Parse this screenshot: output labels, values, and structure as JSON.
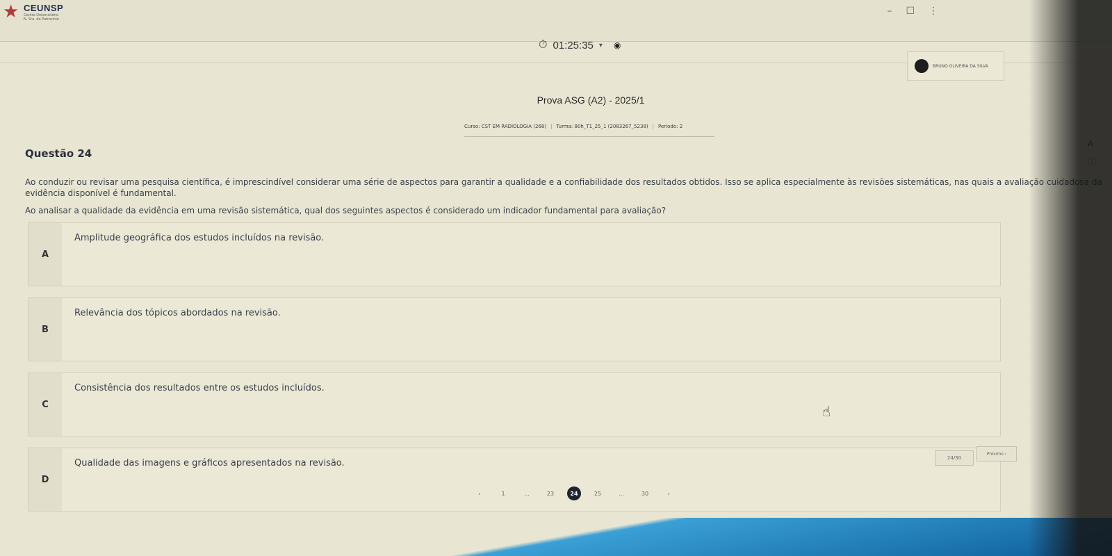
{
  "header": {
    "logo_name": "CEUNSP",
    "logo_sub_1": "Centro Universitário",
    "logo_sub_2": "N. Sra. do Patrocínio",
    "timer": "01:25:35",
    "user_name": "BRUNO OLIVEIRA DA SILVA"
  },
  "exam": {
    "title": "Prova ASG (A2) - 2025/1",
    "course": "Curso: CST EM RADIOLOGIA (268)",
    "class": "Turma: 80h_T1_25_1 (2083267_5238)",
    "period": "Período: 2"
  },
  "question": {
    "title": "Questão 24",
    "text": "Ao conduzir ou revisar uma pesquisa científica, é imprescindível considerar uma série de aspectos para garantir a qualidade e a confiabilidade dos resultados obtidos. Isso se aplica especialmente às revisões sistemáticas, nas quais a avaliação cuidadosa da evidência disponível é fundamental.",
    "prompt": "Ao analisar a qualidade da evidência em uma revisão sistemática, qual dos seguintes aspectos é considerado um indicador fundamental para avaliação?",
    "options": [
      {
        "letter": "A",
        "text": "Amplitude geográfica dos estudos incluídos na revisão."
      },
      {
        "letter": "B",
        "text": "Relevância dos tópicos abordados na revisão."
      },
      {
        "letter": "C",
        "text": "Consistência dos resultados entre os estudos incluídos."
      },
      {
        "letter": "D",
        "text": "Qualidade das imagens e gráficos apresentados na revisão."
      }
    ]
  },
  "pagination": {
    "counter": "24/30",
    "next_label": "Próximo",
    "pages": [
      "1",
      "...",
      "23",
      "24",
      "25",
      "...",
      "30"
    ],
    "current": "24"
  }
}
